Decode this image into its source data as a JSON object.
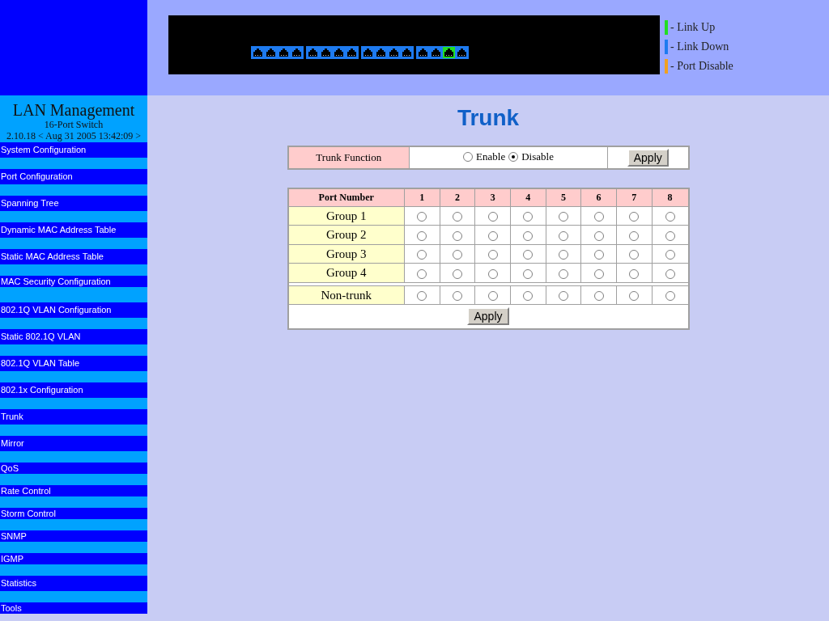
{
  "ports": [
    {
      "link_up": false
    },
    {
      "link_up": false
    },
    {
      "link_up": false
    },
    {
      "link_up": false
    },
    {
      "link_up": false
    },
    {
      "link_up": false
    },
    {
      "link_up": false
    },
    {
      "link_up": false
    },
    {
      "link_up": false
    },
    {
      "link_up": false
    },
    {
      "link_up": false
    },
    {
      "link_up": false
    },
    {
      "link_up": false
    },
    {
      "link_up": false
    },
    {
      "link_up": true
    },
    {
      "link_up": false
    }
  ],
  "legend": [
    {
      "label": "- Link Up",
      "color": "#22dd22"
    },
    {
      "label": "- Link Down",
      "color": "#1e7bf0"
    },
    {
      "label": "- Port Disable",
      "color": "#f0a020"
    }
  ],
  "sidebar": {
    "title": "LAN Management",
    "subtitle": "16-Port Switch",
    "version": "2.10.18 < Aug 31 2005 13:42:09 >",
    "items": [
      "System Configuration",
      "Port Configuration",
      "Spanning Tree",
      "Dynamic MAC Address Table",
      "Static MAC Address Table",
      "MAC Security Configuration",
      "802.1Q VLAN Configuration",
      "Static 802.1Q VLAN",
      "802.1Q VLAN Table",
      "802.1x Configuration",
      "Trunk",
      "Mirror",
      "QoS",
      "Rate Control",
      "Storm Control",
      "SNMP",
      "IGMP",
      "Statistics",
      "Tools"
    ]
  },
  "page_title": "Trunk",
  "trunk_function": {
    "label": "Trunk Function",
    "options": [
      {
        "label": "Enable",
        "selected": false
      },
      {
        "label": "Disable",
        "selected": true
      }
    ],
    "apply": "Apply"
  },
  "table": {
    "header": "Port Number",
    "columns": [
      "1",
      "2",
      "3",
      "4",
      "5",
      "6",
      "7",
      "8"
    ],
    "groups": [
      {
        "label": "Group 1",
        "ports": [
          false,
          false,
          false,
          false,
          false,
          false,
          false,
          false
        ]
      },
      {
        "label": "Group 2",
        "ports": [
          false,
          false,
          false,
          false,
          false,
          false,
          false,
          false
        ]
      },
      {
        "label": "Group 3",
        "ports": [
          false,
          false,
          false,
          false,
          false,
          false,
          false,
          false
        ]
      },
      {
        "label": "Group 4",
        "ports": [
          false,
          false,
          false,
          false,
          false,
          false,
          false,
          false
        ]
      }
    ],
    "non_trunk": {
      "label": "Non-trunk",
      "ports": [
        false,
        false,
        false,
        false,
        false,
        false,
        false,
        false
      ]
    },
    "apply": "Apply"
  }
}
